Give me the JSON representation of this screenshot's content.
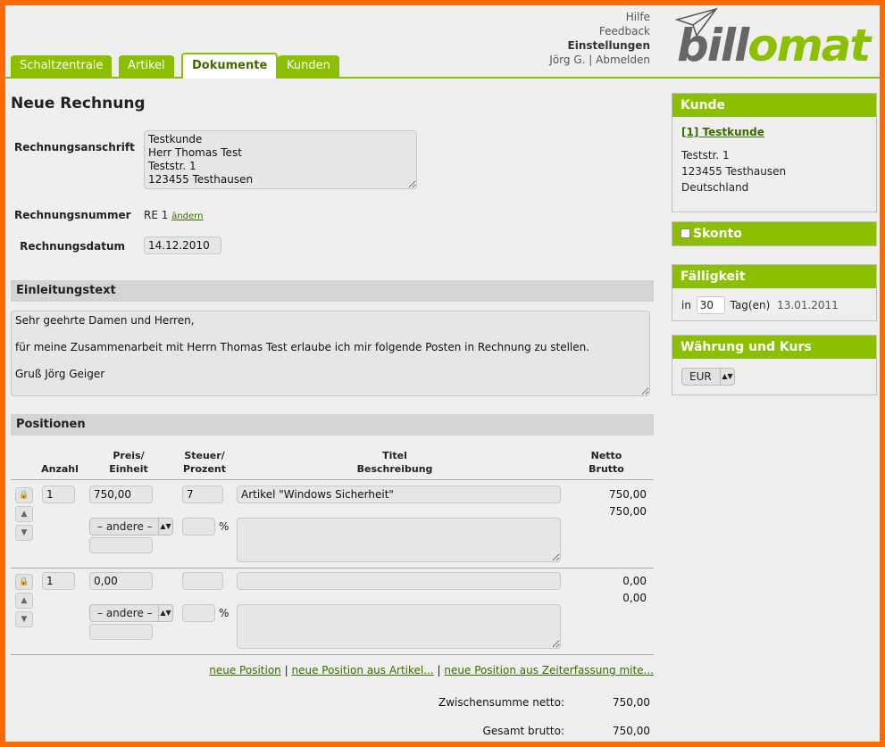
{
  "header": {
    "tabs": [
      {
        "label": "Schaltzentrale"
      },
      {
        "label": "Artikel"
      },
      {
        "label": "Dokumente"
      },
      {
        "label": "Kunden"
      }
    ],
    "links": {
      "help": "Hilfe",
      "feedback": "Feedback",
      "settings": "Einstellungen",
      "user": "Jörg G.",
      "separator": "|",
      "logout": "Abmelden"
    },
    "logo": {
      "part1": "bill",
      "part2": "omat"
    }
  },
  "form": {
    "title": "Neue Rechnung",
    "address_label": "Rechnungsanschrift",
    "address_value": "Testkunde\nHerr Thomas Test\nTeststr. 1\n123455 Testhausen",
    "number_label": "Rechnungsnummer",
    "number_value": "RE 1",
    "number_change": "ändern",
    "date_label": "Rechnungsdatum",
    "date_value": "14.12.2010"
  },
  "intro": {
    "heading": "Einleitungstext",
    "text": "Sehr geehrte Damen und Herren,\n\nfür meine Zusammenarbeit mit Herrn Thomas Test erlaube ich mir folgende Posten in Rechnung zu stellen.\n\nGruß Jörg Geiger"
  },
  "positions": {
    "heading": "Positionen",
    "columns": {
      "anzahl": "Anzahl",
      "preis1": "Preis/",
      "preis2": "Einheit",
      "steuer1": "Steuer/",
      "steuer2": "Prozent",
      "titel1": "Titel",
      "titel2": "Beschreibung",
      "netto1": "Netto",
      "netto2": "Brutto"
    },
    "rows": [
      {
        "qty": "1",
        "price": "750,00",
        "tax": "7",
        "title": "Artikel \"Windows Sicherheit\"",
        "unit": "– andere –",
        "percent": "%",
        "netto": "750,00",
        "brutto": "750,00"
      },
      {
        "qty": "1",
        "price": "0,00",
        "tax": "",
        "title": "",
        "unit": "– andere –",
        "percent": "%",
        "netto": "0,00",
        "brutto": "0,00"
      }
    ],
    "links": {
      "new": "neue Position",
      "sep": "|",
      "from_article": "neue Position aus Artikel...",
      "from_time": "neue Position aus Zeiterfassung mite..."
    },
    "subtotal_label": "Zwischensumme netto:",
    "subtotal_value": "750,00",
    "total_label": "Gesamt brutto:",
    "total_value": "750,00"
  },
  "sidebar": {
    "customer": {
      "heading": "Kunde",
      "link": "[1] Testkunde",
      "street": "Teststr. 1",
      "city": "123455 Testhausen",
      "country": "Deutschland"
    },
    "skonto": {
      "heading": "Skonto"
    },
    "due": {
      "heading": "Fälligkeit",
      "prefix": "in",
      "days": "30",
      "unit": "Tag(en)",
      "date": "13.01.2011"
    },
    "currency": {
      "heading": "Währung und Kurs",
      "value": "EUR"
    }
  },
  "colors": {
    "accent": "#8cbf00",
    "frame": "#ff6a00",
    "link": "#3d6b00"
  }
}
